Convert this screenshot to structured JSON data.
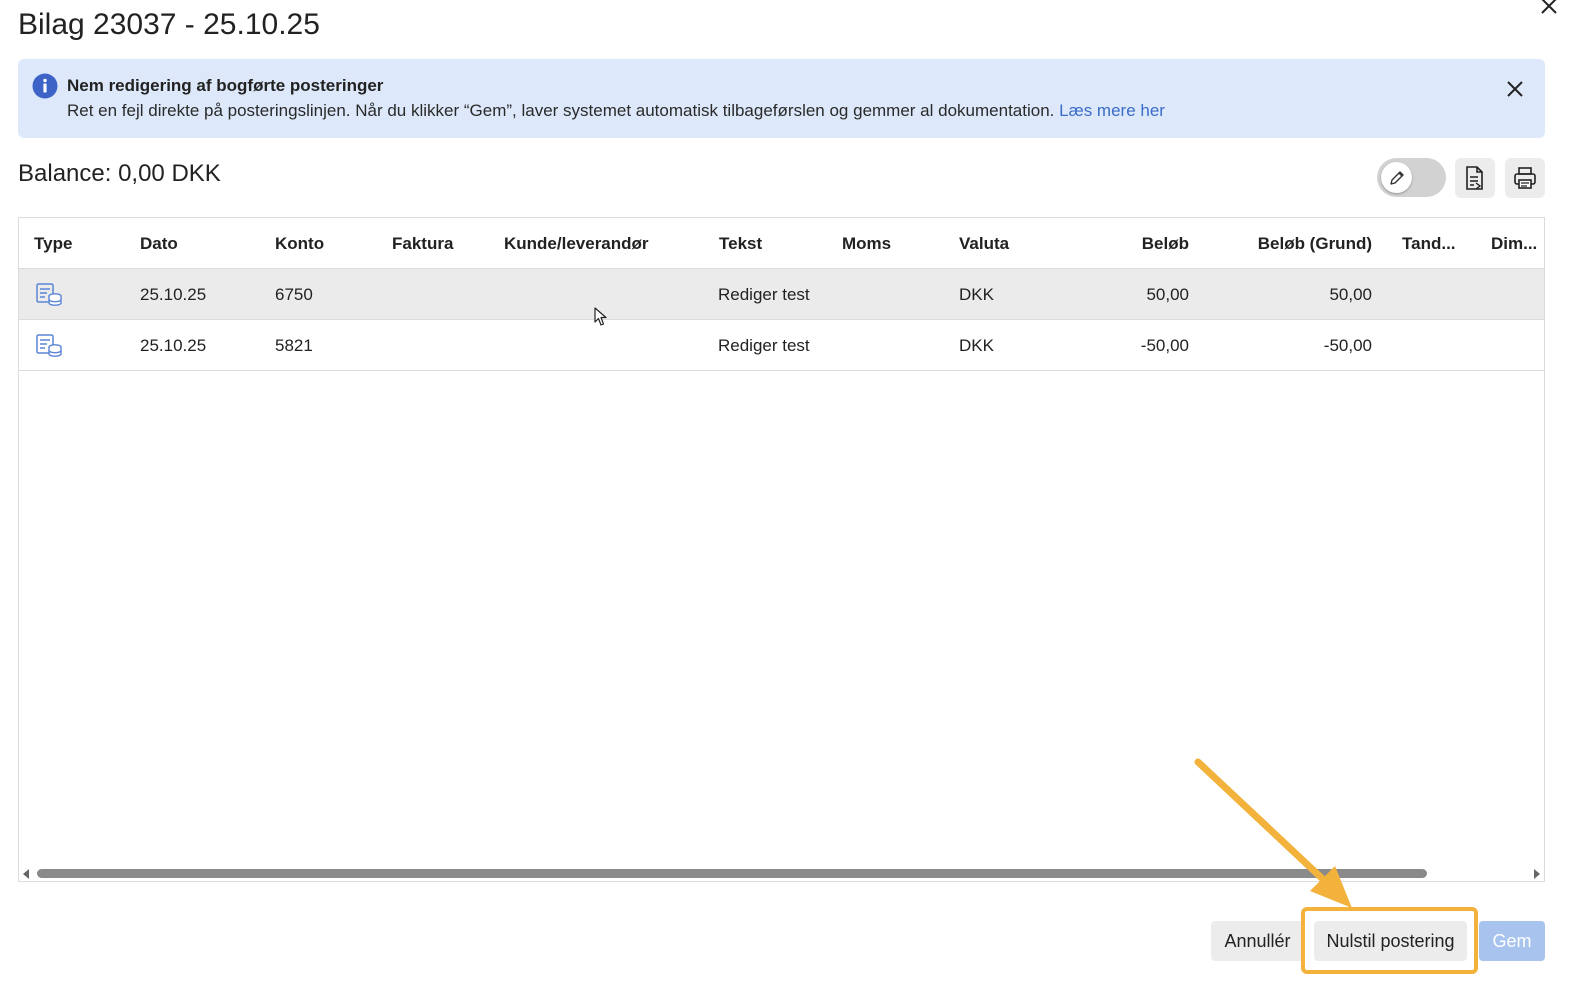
{
  "dialog": {
    "title": "Bilag 23037 - 25.10.25",
    "close_icon": "close-icon"
  },
  "banner": {
    "icon": "info-icon",
    "heading": "Nem redigering af bogførte posteringer",
    "body": "Ret en fejl direkte på posteringslinjen. Når du klikker “Gem”, laver systemet automatisk tilbageførslen og gemmer al dokumentation.",
    "link": "Læs mere her",
    "close_icon": "close-icon",
    "background": "#dde9fb",
    "link_color": "#3a6cc8"
  },
  "toolbar": {
    "balance": "Balance: 0,00 DKK",
    "edit_toggle_icon": "pencil-icon",
    "export_icon": "document-export-icon",
    "print_icon": "printer-icon"
  },
  "table": {
    "columns": [
      "Type",
      "Dato",
      "Konto",
      "Faktura",
      "Kunde/leverandør",
      "Tekst",
      "Moms",
      "Valuta",
      "Beløb",
      "Beløb (Grund)",
      "Tand...",
      "Dim..."
    ],
    "rows": [
      {
        "type_icon": "ledger-coins-icon",
        "dato": "25.10.25",
        "konto": "6750",
        "faktura": "",
        "kunde": "",
        "tekst": "Rediger test",
        "moms": "",
        "valuta": "DKK",
        "belob": "50,00",
        "belob_grund": "50,00",
        "tand": "",
        "dim": ""
      },
      {
        "type_icon": "ledger-coins-icon",
        "dato": "25.10.25",
        "konto": "5821",
        "faktura": "",
        "kunde": "",
        "tekst": "Rediger test",
        "moms": "",
        "valuta": "DKK",
        "belob": "-50,00",
        "belob_grund": "-50,00",
        "tand": "",
        "dim": ""
      }
    ]
  },
  "footer": {
    "cancel_label": "Annullér",
    "reset_label": "Nulstil postering",
    "save_label": "Gem",
    "save_color": "#a7c3ee"
  },
  "annotation": {
    "highlight_color": "#f2b23c"
  }
}
